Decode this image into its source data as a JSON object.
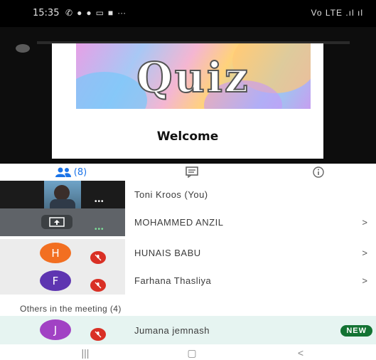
{
  "status_bar": {
    "time": "15:35",
    "left_icons": [
      "whatsapp-icon",
      "messenger-icon",
      "messenger-icon",
      "sim-icon",
      "mail-icon",
      "more-icon"
    ],
    "right_text": "Vo LTE .ıl ıl"
  },
  "presentation": {
    "banner_text": "Quiz",
    "subtitle": "Welcome"
  },
  "tabs": {
    "people_count": "(8)",
    "active": "people"
  },
  "participants": [
    {
      "name": "Toni Kroos (You)",
      "type": "video",
      "has_chevron": false
    },
    {
      "name": "MOHAMMED ANZIL",
      "type": "presenting",
      "has_chevron": true,
      "chevron": ">"
    },
    {
      "name": "HUNAIS BABU",
      "type": "avatar",
      "initial": "H",
      "avatar_color": "#f26f21",
      "muted": true,
      "has_chevron": true,
      "chevron": ">"
    },
    {
      "name": "Farhana Thasliya",
      "type": "avatar",
      "initial": "F",
      "avatar_color": "#5e35b1",
      "muted": true,
      "has_chevron": true,
      "chevron": ">"
    }
  ],
  "others_section": {
    "label": "Others in the meeting (4)",
    "items": [
      {
        "name": "Jumana jemnash",
        "initial": "J",
        "avatar_color": "#a142c4",
        "muted": true,
        "badge": "NEW"
      }
    ]
  },
  "navbar": {
    "recents": "|||",
    "home": "▢",
    "back": "<"
  },
  "colors": {
    "accent": "#1a73e8",
    "mute": "#d93025",
    "new_badge": "#137333",
    "highlight_row": "#e6f4f1"
  }
}
